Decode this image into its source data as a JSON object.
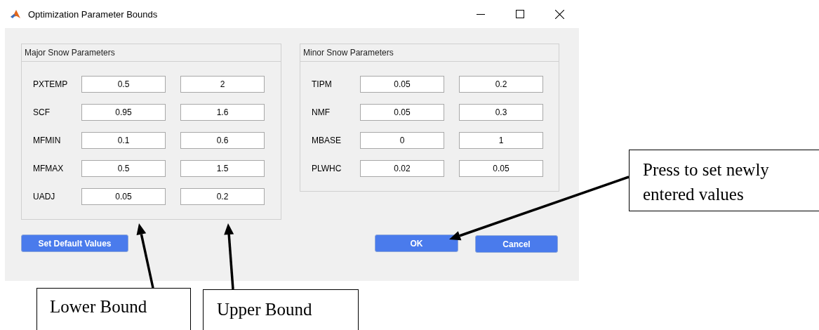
{
  "window": {
    "title": "Optimization Parameter Bounds"
  },
  "panels": [
    {
      "title": "Major Snow Parameters",
      "rows": [
        {
          "label": "PXTEMP",
          "lower": "0.5",
          "upper": "2"
        },
        {
          "label": "SCF",
          "lower": "0.95",
          "upper": "1.6"
        },
        {
          "label": "MFMIN",
          "lower": "0.1",
          "upper": "0.6"
        },
        {
          "label": "MFMAX",
          "lower": "0.5",
          "upper": "1.5"
        },
        {
          "label": "UADJ",
          "lower": "0.05",
          "upper": "0.2"
        }
      ]
    },
    {
      "title": "Minor Snow Parameters",
      "rows": [
        {
          "label": "TIPM",
          "lower": "0.05",
          "upper": "0.2"
        },
        {
          "label": "NMF",
          "lower": "0.05",
          "upper": "0.3"
        },
        {
          "label": "MBASE",
          "lower": "0",
          "upper": "1"
        },
        {
          "label": "PLWHC",
          "lower": "0.02",
          "upper": "0.05"
        }
      ]
    }
  ],
  "default_button": "Set Default Values",
  "buttons": [
    "OK",
    "Cancel"
  ],
  "annotations": [
    {
      "text": "Lower Bound"
    },
    {
      "text": "Upper Bound"
    },
    {
      "text": "Press to set newly entered values"
    }
  ]
}
